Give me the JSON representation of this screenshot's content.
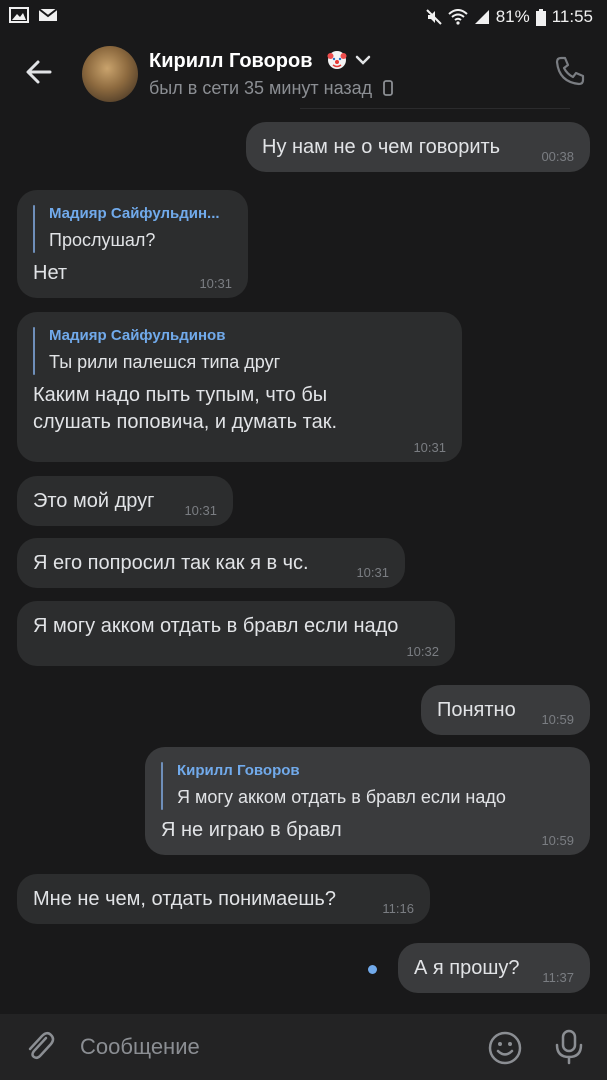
{
  "status_bar": {
    "battery": "81%",
    "time": "11:55"
  },
  "header": {
    "name": "Кирилл Говоров",
    "last_seen": "был в сети 35 минут назад"
  },
  "messages": [
    {
      "type": "out",
      "text": "Ну нам не о чем говорить",
      "time": "00:38"
    },
    {
      "type": "in",
      "reply_name": "Мадияр Сайфульдин...",
      "reply_text": "Прослушал?",
      "text": "Нет",
      "time": "10:31"
    },
    {
      "type": "in",
      "reply_name": "Мадияр Сайфульдинов",
      "reply_text": "Ты рили палешся типа друг",
      "text": "Каким надо пыть тупым, что бы слушать поповича, и думать так.",
      "time": "10:31"
    },
    {
      "type": "in",
      "text": "Это мой друг",
      "time": "10:31"
    },
    {
      "type": "in",
      "text": "Я его попросил так как я в чс.",
      "time": "10:31"
    },
    {
      "type": "in",
      "text": "Я могу акком отдать в бравл если надо",
      "time": "10:32"
    },
    {
      "type": "out",
      "text": "Понятно",
      "time": "10:59"
    },
    {
      "type": "out",
      "reply_name": "Кирилл Говоров",
      "reply_text": "Я могу акком отдать в бравл если надо",
      "text": "Я не играю в бравл",
      "time": "10:59"
    },
    {
      "type": "in",
      "text": "Мне не чем, отдать понимаешь?",
      "time": "11:16"
    },
    {
      "type": "out",
      "text": "А я прошу?",
      "time": "11:37",
      "unread": true
    }
  ],
  "composer": {
    "placeholder": "Сообщение"
  },
  "colors": {
    "background": "#19191a",
    "bubble_in": "#2c2d2e",
    "bubble_out": "#3a3b3d",
    "accent": "#71aaeb"
  }
}
